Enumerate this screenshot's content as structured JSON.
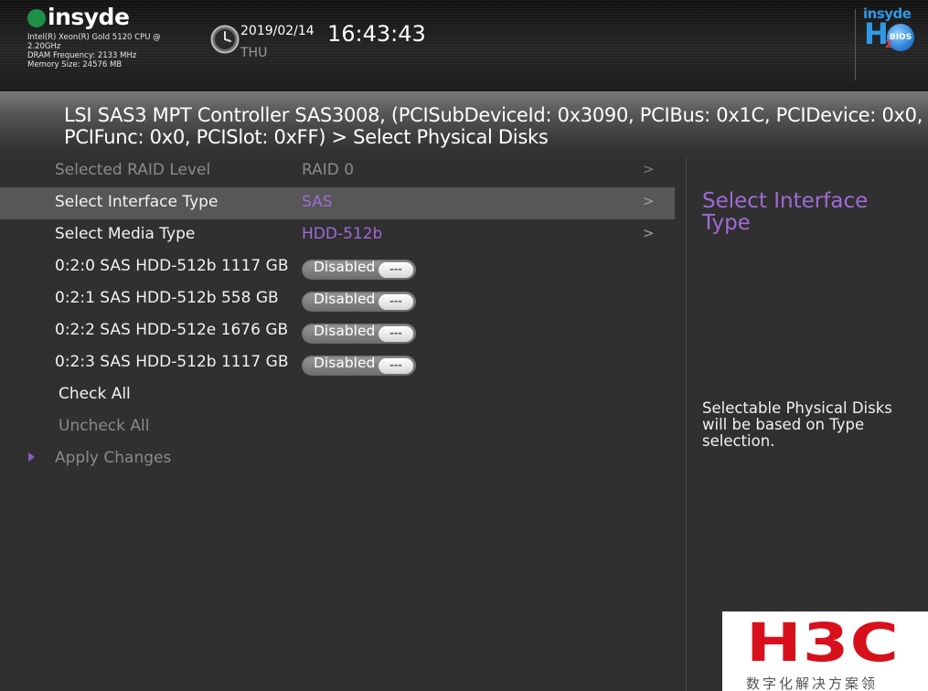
{
  "header": {
    "brand": "insyde",
    "cpu": "Intel(R) Xeon(R) Gold 5120 CPU @ 2.20GHz",
    "dram": "DRAM Frequency: 2133 MHz",
    "memory": "Memory Size: 24576 MB",
    "date": "2019/02/14",
    "day": "THU",
    "time": "16:43:43",
    "h2_logo": {
      "brand": "insyde",
      "letter": "H",
      "sub": "2",
      "badge": "BIOS"
    }
  },
  "page_title": "LSI SAS3 MPT Controller SAS3008, (PCISubDeviceId: 0x3090, PCIBus: 0x1C, PCIDevice: 0x0, PCIFunc: 0x0, PCISlot: 0xFF) > Select Physical Disks",
  "menu": {
    "items": [
      {
        "label": "Selected RAID Level",
        "value": "RAID 0",
        "arrow": ">"
      },
      {
        "label": "Select Interface Type",
        "value": "SAS",
        "arrow": ">"
      },
      {
        "label": "Select Media Type",
        "value": "HDD-512b",
        "arrow": ">"
      },
      {
        "label": "0:2:0 SAS HDD-512b 1117 GB",
        "toggle": "Disabled",
        "knob": "---"
      },
      {
        "label": "0:2:1 SAS HDD-512b 558 GB",
        "toggle": "Disabled",
        "knob": "---"
      },
      {
        "label": "0:2:2 SAS HDD-512e 1676 GB",
        "toggle": "Disabled",
        "knob": "---"
      },
      {
        "label": "0:2:3 SAS HDD-512b 1117 GB",
        "toggle": "Disabled",
        "knob": "---"
      },
      {
        "label": "Check All"
      },
      {
        "label": "Uncheck All"
      },
      {
        "label": "Apply Changes"
      }
    ]
  },
  "help": {
    "title": "Select Interface Type",
    "text": "Selectable Physical Disks will be based on Type selection."
  },
  "watermark": {
    "logo": "H3C",
    "subtitle": "数字化解决方案领"
  },
  "colors": {
    "background": "#303030",
    "highlight": "#575757",
    "accent_purple": "#a06ad6",
    "dim_text": "#8a8a8a",
    "brand_green": "#1e8f47",
    "h2_blue": "#2e9ae6",
    "h3c_red": "#d8101c"
  }
}
